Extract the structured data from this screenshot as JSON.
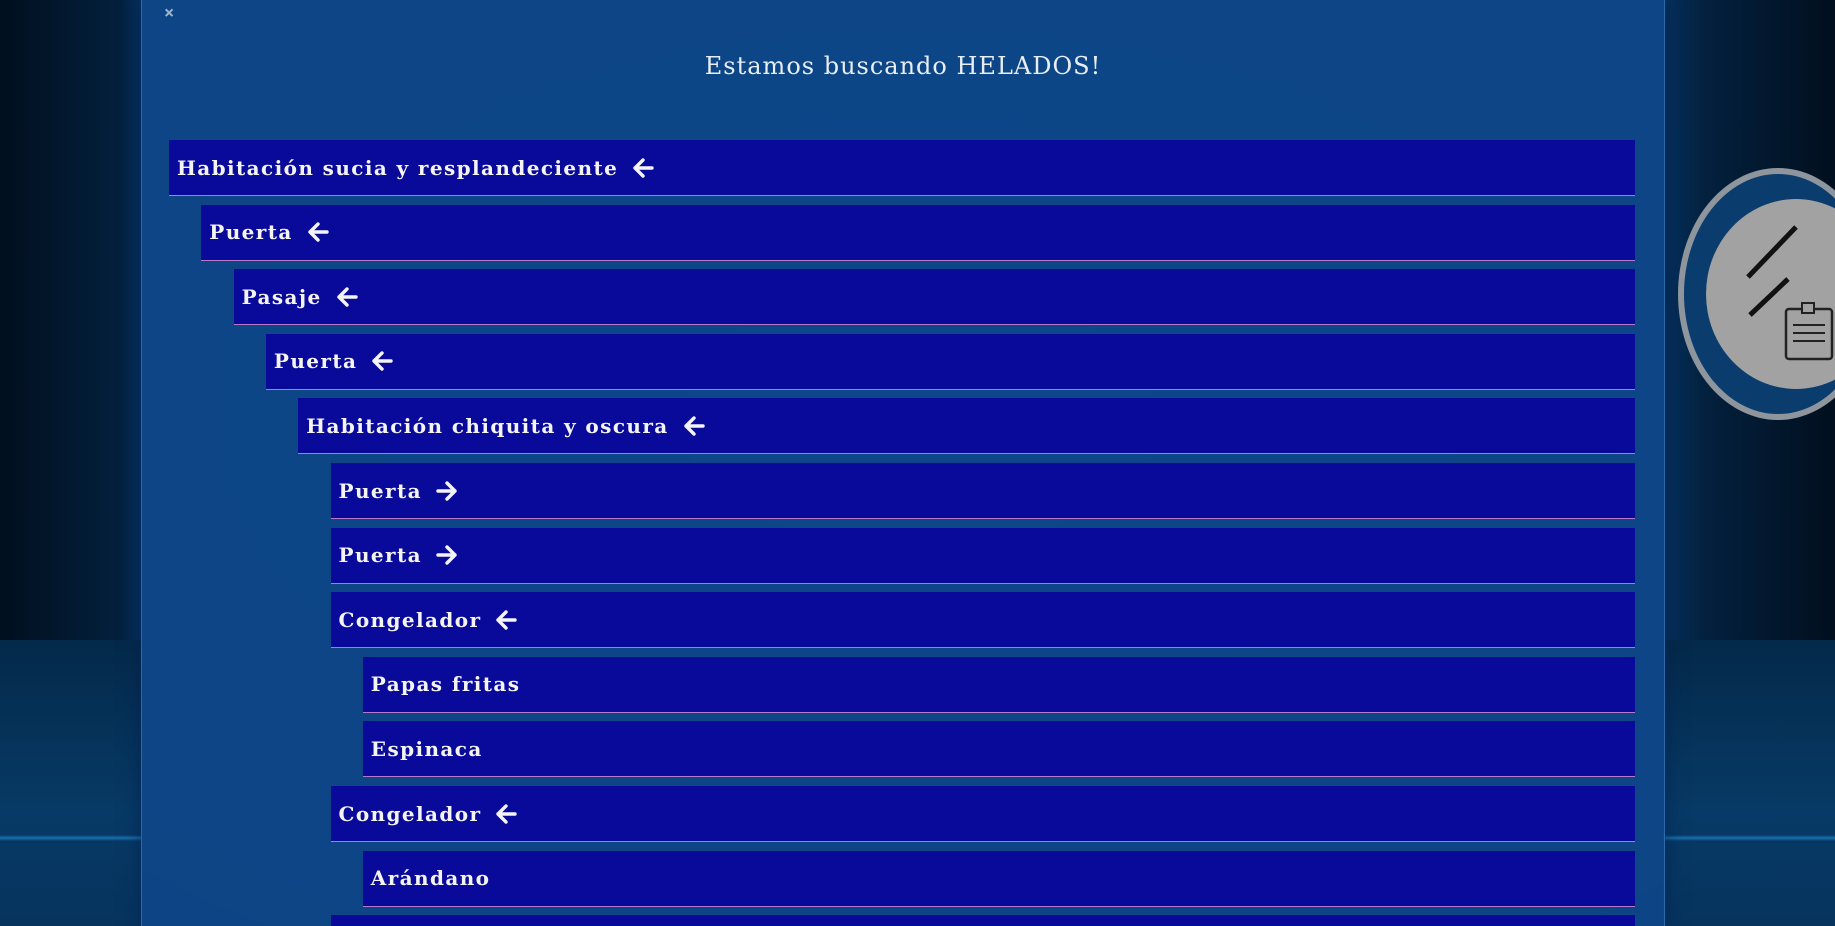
{
  "modal": {
    "close_symbol": "×",
    "title": "Estamos buscando HELADOS!"
  },
  "tree": {
    "rows": [
      {
        "label": "Habitación sucia y resplandeciente",
        "depth": 0,
        "arrow": "left"
      },
      {
        "label": "Puerta",
        "depth": 1,
        "arrow": "left"
      },
      {
        "label": "Pasaje",
        "depth": 2,
        "arrow": "left"
      },
      {
        "label": "Puerta",
        "depth": 3,
        "arrow": "left"
      },
      {
        "label": "Habitación chiquita y oscura",
        "depth": 4,
        "arrow": "left"
      },
      {
        "label": "Puerta",
        "depth": 5,
        "arrow": "right"
      },
      {
        "label": "Puerta",
        "depth": 5,
        "arrow": "right"
      },
      {
        "label": "Congelador",
        "depth": 5,
        "arrow": "left"
      },
      {
        "label": "Papas fritas",
        "depth": 6,
        "arrow": "none"
      },
      {
        "label": "Espinaca",
        "depth": 6,
        "arrow": "none"
      },
      {
        "label": "Congelador",
        "depth": 5,
        "arrow": "left"
      },
      {
        "label": "Arándano",
        "depth": 6,
        "arrow": "none"
      },
      {
        "label": "",
        "depth": 5,
        "arrow": "none"
      }
    ]
  },
  "icons": {
    "close": "close-icon",
    "arrow_left": "arrow-left-icon",
    "arrow_right": "arrow-right-icon",
    "notepad": "notepad-icon"
  },
  "colors": {
    "row_bg": "#0a0a9a",
    "row_border": "#b47ac8",
    "modal_bg": "#0e488c",
    "text": "#f4f4f4"
  }
}
